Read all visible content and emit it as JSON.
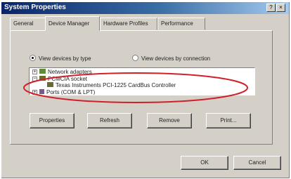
{
  "window": {
    "title": "System Properties",
    "help_label": "?",
    "close_label": "×"
  },
  "tabs": [
    {
      "label": "General"
    },
    {
      "label": "Device Manager"
    },
    {
      "label": "Hardware Profiles"
    },
    {
      "label": "Performance"
    }
  ],
  "view_options": {
    "by_type": {
      "label": "View devices by type",
      "selected": true
    },
    "by_connection": {
      "label": "View devices by connection",
      "selected": false
    }
  },
  "device_tree": [
    {
      "label": "Network adapters",
      "expander": "+"
    },
    {
      "label": "PCMCIA socket",
      "expander": "−"
    },
    {
      "label": "Texas Instruments PCI-1225 CardBus Controller"
    },
    {
      "label": "Ports (COM & LPT)",
      "expander": "+"
    }
  ],
  "buttons": {
    "properties": "Properties",
    "refresh": "Refresh",
    "remove": "Remove",
    "print": "Print...",
    "ok": "OK",
    "cancel": "Cancel"
  },
  "colors": {
    "titlebar": "#0a246a",
    "face": "#d4d0c8",
    "highlight_ellipse": "#d0202a"
  }
}
